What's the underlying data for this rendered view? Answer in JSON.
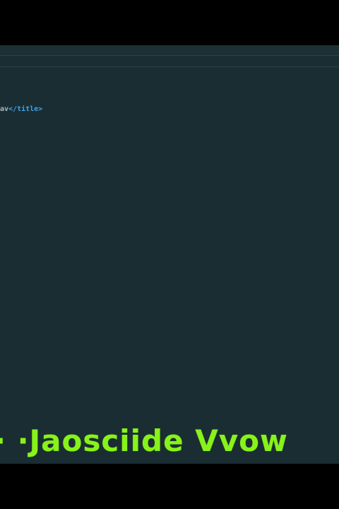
{
  "editor": {
    "code_lines": [
      {
        "text": "av",
        "tag_close": "</title>"
      }
    ]
  },
  "overlay": {
    "caption": "· ·Jaosciide Vvow"
  },
  "colors": {
    "editor_background": "#1a2d33",
    "tag_color": "#3fa3e8",
    "text_color": "#a9b7bc",
    "caption_color": "#88f21a",
    "letterbox": "#000000"
  }
}
